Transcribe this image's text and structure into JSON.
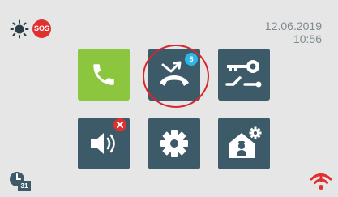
{
  "status": {
    "date": "12.06.2019",
    "time": "10:56",
    "sos_label": "SOS"
  },
  "tiles": {
    "missed_calls_count": "8"
  },
  "footer": {
    "calendar_day": "31"
  },
  "icons": {
    "day_mode": "sun-icon",
    "sos": "sos-icon",
    "call": "phone-icon",
    "missed_calls": "missed-call-icon",
    "door_lock": "key-switch-icon",
    "volume": "speaker-muted-icon",
    "settings": "gear-icon",
    "guard": "guard-house-settings-icon",
    "schedule": "clock-calendar-icon",
    "network": "wifi-alert-icon"
  },
  "colors": {
    "background": "#e6e6e6",
    "tile_dark": "#3c5a68",
    "tile_green": "#8cc63f",
    "alert_red": "#e03030",
    "badge_blue": "#2fb6e8",
    "highlight_red": "#d8262d",
    "datetime_text": "#7f8a91"
  }
}
